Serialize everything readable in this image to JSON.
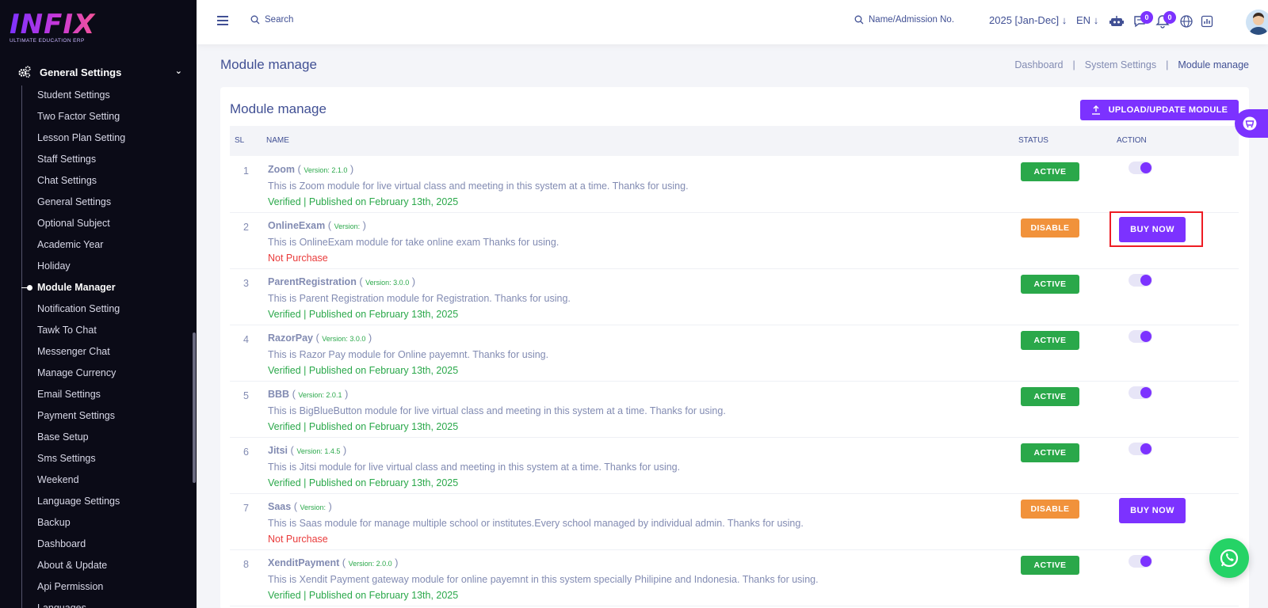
{
  "brand": {
    "logo_text": "INFIX",
    "tagline": "ULTIMATE EDUCATION ERP"
  },
  "sidebar": {
    "section_label": "General Settings",
    "items": [
      {
        "label": "Student Settings"
      },
      {
        "label": "Two Factor Setting"
      },
      {
        "label": "Lesson Plan Setting"
      },
      {
        "label": "Staff Settings"
      },
      {
        "label": "Chat Settings"
      },
      {
        "label": "General Settings"
      },
      {
        "label": "Optional Subject"
      },
      {
        "label": "Academic Year"
      },
      {
        "label": "Holiday"
      },
      {
        "label": "Module Manager",
        "active": true
      },
      {
        "label": "Notification Setting"
      },
      {
        "label": "Tawk To Chat"
      },
      {
        "label": "Messenger Chat"
      },
      {
        "label": "Manage Currency"
      },
      {
        "label": "Email Settings"
      },
      {
        "label": "Payment Settings"
      },
      {
        "label": "Base Setup"
      },
      {
        "label": "Sms Settings"
      },
      {
        "label": "Weekend"
      },
      {
        "label": "Language Settings"
      },
      {
        "label": "Backup"
      },
      {
        "label": "Dashboard"
      },
      {
        "label": "About & Update"
      },
      {
        "label": "Api Permission"
      },
      {
        "label": "Languages"
      }
    ]
  },
  "topbar": {
    "search_placeholder": "Search",
    "name_search_placeholder": "Name/Admission No.",
    "academic_year": "2025 [Jan-Dec]",
    "language": "EN",
    "chat_count": "0",
    "notification_count": "0"
  },
  "page": {
    "title": "Module manage",
    "breadcrumb": [
      "Dashboard",
      "System Settings",
      "Module manage"
    ]
  },
  "card": {
    "title": "Module manage",
    "upload_button": "UPLOAD/UPDATE MODULE",
    "columns": {
      "sl": "SL",
      "name": "NAME",
      "status": "STATUS",
      "action": "ACTION"
    }
  },
  "modules": [
    {
      "sl": "1",
      "name": "Zoom",
      "version": "Version: 2.1.0",
      "description": "This is Zoom module for live virtual class and meeting in this system at a time. Thanks for using.",
      "meta": "Verified | Published on February 13th, 2025",
      "status": "ACTIVE",
      "enabled": true
    },
    {
      "sl": "2",
      "name": "OnlineExam",
      "version": "Version:",
      "description": "This is OnlineExam module for take online exam Thanks for using.",
      "meta": "Not Purchase",
      "status": "DISABLE",
      "action": "BUY NOW"
    },
    {
      "sl": "3",
      "name": "ParentRegistration",
      "version": "Version: 3.0.0",
      "description": "This is Parent Registration module for Registration. Thanks for using.",
      "meta": "Verified | Published on February 13th, 2025",
      "status": "ACTIVE",
      "enabled": true
    },
    {
      "sl": "4",
      "name": "RazorPay",
      "version": "Version: 3.0.0",
      "description": "This is Razor Pay module for Online payemnt. Thanks for using.",
      "meta": "Verified | Published on February 13th, 2025",
      "status": "ACTIVE",
      "enabled": true
    },
    {
      "sl": "5",
      "name": "BBB",
      "version": "Version: 2.0.1",
      "description": "This is BigBlueButton module for live virtual class and meeting in this system at a time. Thanks for using.",
      "meta": "Verified | Published on February 13th, 2025",
      "status": "ACTIVE",
      "enabled": true
    },
    {
      "sl": "6",
      "name": "Jitsi",
      "version": "Version: 1.4.5",
      "description": "This is Jitsi module for live virtual class and meeting in this system at a time. Thanks for using.",
      "meta": "Verified | Published on February 13th, 2025",
      "status": "ACTIVE",
      "enabled": true
    },
    {
      "sl": "7",
      "name": "Saas",
      "version": "Version:",
      "description": "This is Saas module for manage multiple school or institutes.Every school managed by individual admin. Thanks for using.",
      "meta": "Not Purchase",
      "status": "DISABLE",
      "action": "BUY NOW"
    },
    {
      "sl": "8",
      "name": "XenditPayment",
      "version": "Version: 2.0.0",
      "description": "This is Xendit Payment gateway module for online payemnt in this system specially Philipine and Indonesia. Thanks for using.",
      "meta": "Verified | Published on February 13th, 2025",
      "status": "ACTIVE",
      "enabled": true
    }
  ],
  "colors": {
    "accent": "#7c32ff",
    "active": "#2aa84a",
    "disable": "#f1923b",
    "error": "#e93a3a",
    "sidebar_bg": "#0b0b17"
  },
  "icons": {
    "whatsapp": "whatsapp-icon",
    "float": "cart-icon"
  }
}
